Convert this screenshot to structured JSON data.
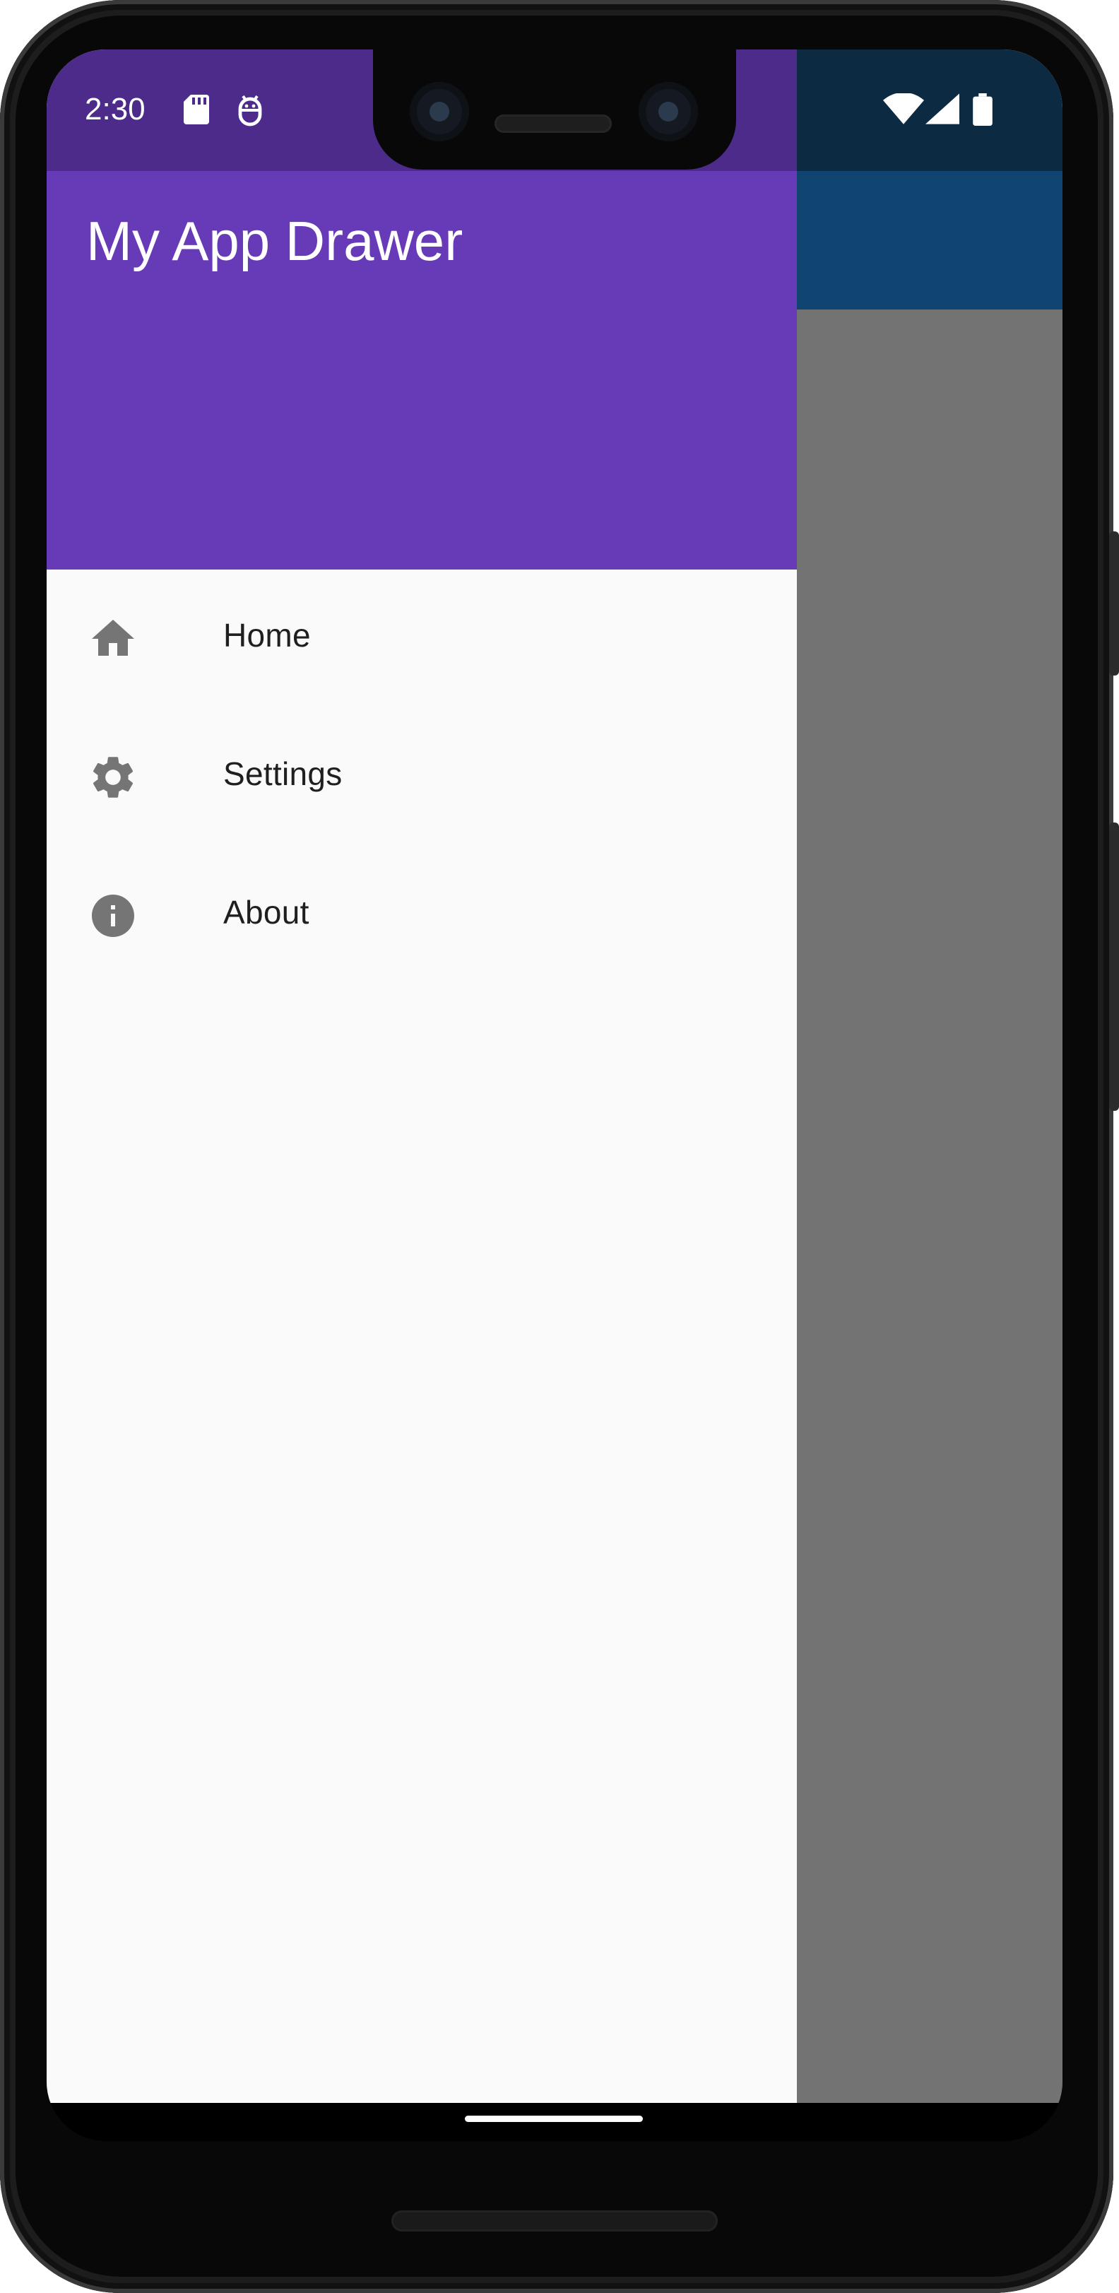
{
  "status_bar": {
    "time": "2:30",
    "left_icons": [
      "sd-card-icon",
      "android-debug-icon"
    ],
    "right_icons": [
      "wifi-icon",
      "cell-signal-icon",
      "battery-icon"
    ]
  },
  "drawer": {
    "title": "My App Drawer",
    "items": [
      {
        "label": "Home",
        "icon": "home-icon"
      },
      {
        "label": "Settings",
        "icon": "gear-icon"
      },
      {
        "label": "About",
        "icon": "info-icon"
      }
    ]
  },
  "colors": {
    "drawer_header": "#673ab7",
    "drawer_status": "#4c2b8a",
    "app_bar": "#2196f3",
    "icon_gray": "#757575",
    "scrim": "rgba(0,0,0,0.54)"
  }
}
